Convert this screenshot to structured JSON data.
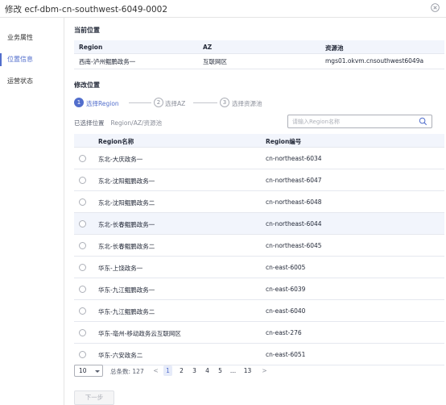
{
  "window": {
    "title": "修改 ecf-dbm-cn-southwest-6049-0002"
  },
  "sidebar": {
    "items": [
      {
        "label": "业务属性",
        "active": false
      },
      {
        "label": "位置信息",
        "active": true
      },
      {
        "label": "运营状态",
        "active": false
      }
    ]
  },
  "current_location": {
    "section_title": "当前位置",
    "headers": {
      "region": "Region",
      "az": "AZ",
      "pool": "资源池"
    },
    "row": {
      "region": "西南-泸州鲲鹏政务一",
      "az": "互联网区",
      "pool": "mgs01.okvm.cnsouthwest6049a"
    }
  },
  "modify_location": {
    "section_title": "修改位置",
    "steps": [
      {
        "number": "1",
        "label": "选择Region",
        "active": true
      },
      {
        "number": "2",
        "label": "选择AZ",
        "active": false
      },
      {
        "number": "3",
        "label": "选择资源池",
        "active": false
      }
    ],
    "selected_label": "已选择位置",
    "selected_hint": "Region/AZ/资源池",
    "search": {
      "placeholder": "请输入Region名称",
      "value": ""
    }
  },
  "region_table": {
    "headers": {
      "name": "Region名称",
      "code": "Region编号"
    },
    "rows": [
      {
        "name": "东北-大庆政务一",
        "code": "cn-northeast-6034"
      },
      {
        "name": "东北-沈阳鲲鹏政务一",
        "code": "cn-northeast-6047"
      },
      {
        "name": "东北-沈阳鲲鹏政务二",
        "code": "cn-northeast-6048"
      },
      {
        "name": "东北-长春鲲鹏政务一",
        "code": "cn-northeast-6044"
      },
      {
        "name": "东北-长春鲲鹏政务二",
        "code": "cn-northeast-6045"
      },
      {
        "name": "华东-上饶政务一",
        "code": "cn-east-6005"
      },
      {
        "name": "华东-九江鲲鹏政务一",
        "code": "cn-east-6039"
      },
      {
        "name": "华东-九江鲲鹏政务二",
        "code": "cn-east-6040"
      },
      {
        "name": "华东-亳州-移动政务云互联网区",
        "code": "cn-east-276"
      },
      {
        "name": "华东-六安政务二",
        "code": "cn-east-6051"
      }
    ]
  },
  "pagination": {
    "page_size": "10",
    "total_label": "总条数: 127",
    "prev": "<",
    "next": ">",
    "pages": [
      "1",
      "2",
      "3",
      "4",
      "5",
      "...",
      "13"
    ],
    "current": "1"
  },
  "footer": {
    "next_button": "下一步"
  },
  "colors": {
    "accent": "#526ecc",
    "header_bg": "#f2f5fc",
    "border": "#e5e8ef"
  }
}
